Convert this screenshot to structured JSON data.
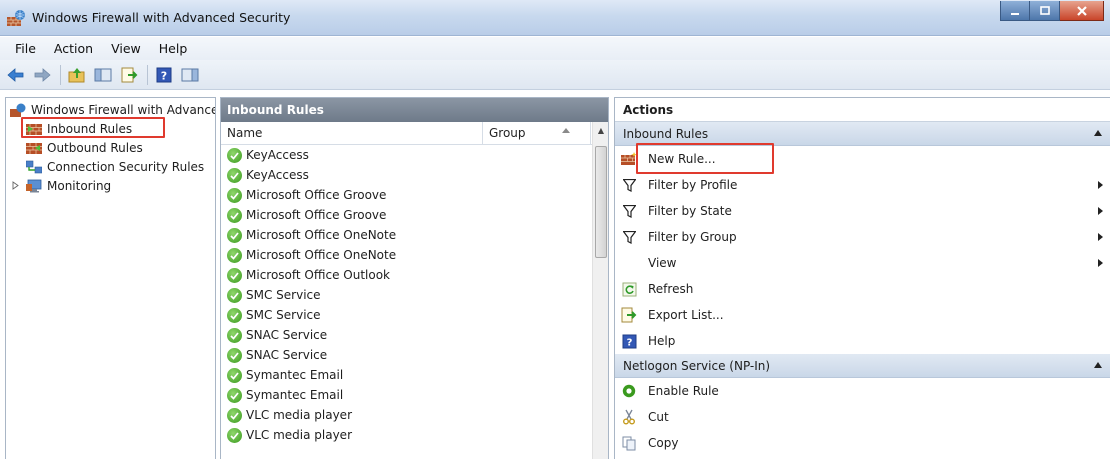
{
  "window": {
    "title": "Windows Firewall with Advanced Security"
  },
  "menu": [
    "File",
    "Action",
    "View",
    "Help"
  ],
  "toolbar_icons": [
    "back-icon",
    "forward-icon",
    "up-folder-icon",
    "show-hide-console-tree-icon",
    "export-list-icon",
    "help-icon",
    "show-hide-action-pane-icon"
  ],
  "tree": {
    "root": "Windows Firewall with Advanced Security",
    "items": [
      {
        "label": "Inbound Rules",
        "icon": "inbound-rules-icon",
        "highlighted": true
      },
      {
        "label": "Outbound Rules",
        "icon": "outbound-rules-icon"
      },
      {
        "label": "Connection Security Rules",
        "icon": "connection-security-icon"
      },
      {
        "label": "Monitoring",
        "icon": "monitoring-icon",
        "expandable": true
      }
    ]
  },
  "middle": {
    "title": "Inbound Rules",
    "columns": {
      "name": "Name",
      "group": "Group"
    },
    "rules": [
      "KeyAccess",
      "KeyAccess",
      "Microsoft Office Groove",
      "Microsoft Office Groove",
      "Microsoft Office OneNote",
      "Microsoft Office OneNote",
      "Microsoft Office Outlook",
      "SMC Service",
      "SMC Service",
      "SNAC Service",
      "SNAC Service",
      "Symantec Email",
      "Symantec Email",
      "VLC media player",
      "VLC media player"
    ]
  },
  "actions": {
    "title": "Actions",
    "section1": {
      "title": "Inbound Rules",
      "items": [
        {
          "label": "New Rule...",
          "icon": "new-rule-icon",
          "highlighted": true
        },
        {
          "label": "Filter by Profile",
          "icon": "filter-icon",
          "submenu": true
        },
        {
          "label": "Filter by State",
          "icon": "filter-icon",
          "submenu": true
        },
        {
          "label": "Filter by Group",
          "icon": "filter-icon",
          "submenu": true
        },
        {
          "label": "View",
          "icon": "",
          "submenu": true
        },
        {
          "label": "Refresh",
          "icon": "refresh-icon"
        },
        {
          "label": "Export List...",
          "icon": "export-list-icon"
        },
        {
          "label": "Help",
          "icon": "help-icon"
        }
      ]
    },
    "section2": {
      "title": "Netlogon Service (NP-In)",
      "items": [
        {
          "label": "Enable Rule",
          "icon": "enable-rule-icon"
        },
        {
          "label": "Cut",
          "icon": "cut-icon"
        },
        {
          "label": "Copy",
          "icon": "copy-icon"
        }
      ]
    }
  },
  "colors": {
    "highlight": "#e03a2e",
    "rule_enabled": "#3a9a1e",
    "header_gray": "#7a8594",
    "section_blue": "#c9d7e8"
  }
}
